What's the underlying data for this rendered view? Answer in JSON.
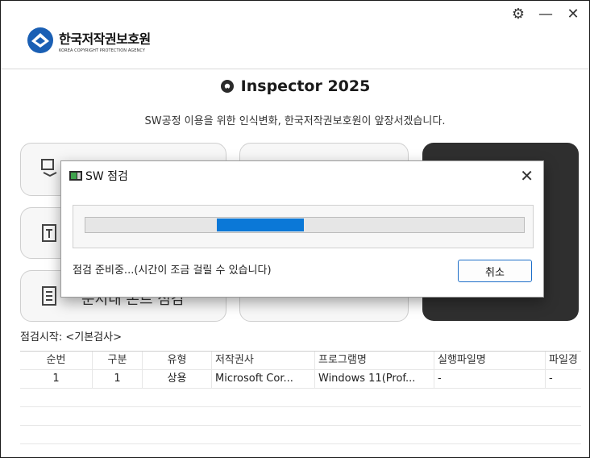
{
  "window": {
    "controls": [
      {
        "icon": "settings-icon",
        "glyph": "⚙"
      },
      {
        "icon": "minimize-icon",
        "glyph": "—"
      },
      {
        "icon": "close-icon",
        "glyph": "✕"
      }
    ]
  },
  "logo": {
    "ko": "한국저작권보호원",
    "en": "KOREA COPYRIGHT PROTECTION AGENCY"
  },
  "app": {
    "title": "Inspector 2025",
    "subtitle": "SW공정 이용을 위한 인식변화, 한국저작권보호원이 앞장서겠습니다.",
    "card_label_partial": "문서내 폰트 점검",
    "start_label": "점검시작: <기본검사>"
  },
  "table": {
    "headers": [
      "순번",
      "구분",
      "유형",
      "저작권사",
      "프로그램명",
      "실행파일명",
      "파일경"
    ],
    "rows": [
      [
        "1",
        "1",
        "상용",
        "Microsoft Cor...",
        "Windows 11(Prof...",
        "-",
        "-"
      ]
    ]
  },
  "dialog": {
    "title": "SW 점검",
    "close_glyph": "✕",
    "progress": 0.4,
    "message": "점검 준비중...(시간이 조금 걸릴 수 있습니다)",
    "cancel_label": "취소"
  },
  "colors": {
    "accent": "#0b78d7",
    "dark_card": "#2f2f2f",
    "logo_blue": "#1a5fb4"
  }
}
